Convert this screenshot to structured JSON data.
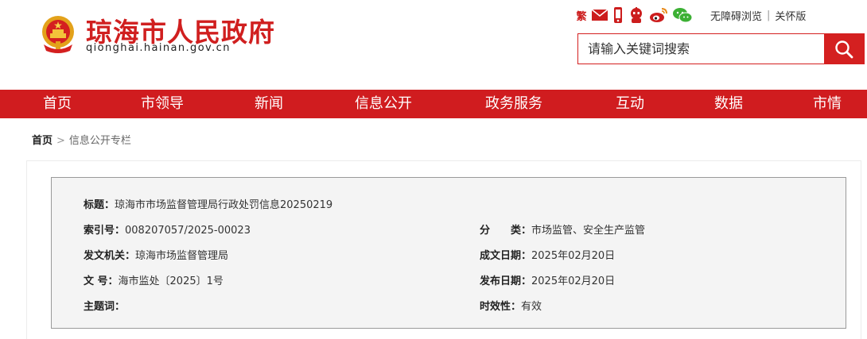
{
  "header": {
    "site_title": "琼海市人民政府",
    "site_domain": "qionghai.hainan.gov.cn",
    "tools": {
      "traditional": "繁",
      "icons": [
        "mail-icon",
        "mobile-icon",
        "robot-icon",
        "weibo-icon",
        "wechat-icon"
      ]
    },
    "accessibility": "无障碍浏览",
    "elder_mode": "关怀版",
    "search": {
      "placeholder": "请输入关键词搜索",
      "button_icon": "search-icon"
    }
  },
  "nav": {
    "items": [
      "首页",
      "市领导",
      "新闻",
      "信息公开",
      "政务服务",
      "互动",
      "数据",
      "市情"
    ]
  },
  "breadcrumb": {
    "home": "首页",
    "separator": ">",
    "current": "信息公开专栏"
  },
  "meta": {
    "title_label": "标题：",
    "title_value": "琼海市市场监督管理局行政处罚信息20250219",
    "index_label": "索引号：",
    "index_value": "008207057/2025-00023",
    "category_label": "分　　类：",
    "category_value": "市场监管、安全生产监管",
    "issuer_label": "发文机关：",
    "issuer_value": "琼海市场监督管理局",
    "date_written_label": "成文日期：",
    "date_written_value": "2025年02月20日",
    "doc_no_label": "文  号：",
    "doc_no_value": "海市监处〔2025〕1号",
    "publish_date_label": "发布日期：",
    "publish_date_value": "2025年02月20日",
    "subject_label": "主题词：",
    "subject_value": "",
    "validity_label": "时效性：",
    "validity_value": "有效"
  },
  "colors": {
    "brand_red": "#d01c1f",
    "meta_bg": "#f4f4f4"
  }
}
